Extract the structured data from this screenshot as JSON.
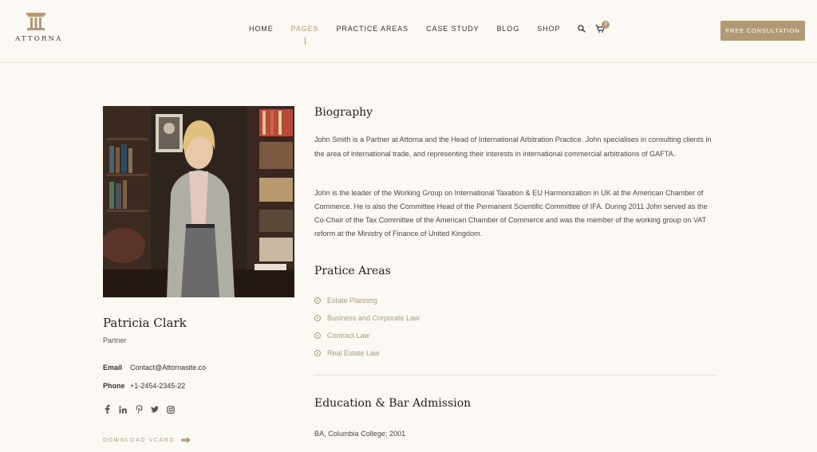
{
  "brand": {
    "name": "ATTORNA"
  },
  "nav": {
    "items": [
      "HOME",
      "PAGES",
      "PRACTICE AREAS",
      "CASE STUDY",
      "BLOG",
      "SHOP"
    ],
    "active_index": 1,
    "cart_count": "0"
  },
  "cta": {
    "label": "FREE CONSULTATION"
  },
  "profile": {
    "name": "Patricia Clark",
    "role": "Partner",
    "email_label": "Email",
    "email": "Contact@Attornasite.co",
    "phone_label": "Phone",
    "phone": "+1-2454-2345-22",
    "socials": [
      "facebook-icon",
      "linkedin-icon",
      "pinterest-icon",
      "twitter-icon",
      "instagram-icon"
    ],
    "vcard_label": "DOWNLOAD VCARD"
  },
  "biography": {
    "title": "Biography",
    "p1": "John Smith is a Partner at Attorna and the Head of International Arbitration Practice. John specialises in consulting clients in the area of international trade, and representing their interests in international commercial arbitrations of GAFTA.",
    "p2": "John is the leader of the Working Group on International Taxation & EU Harmonization in UK at the American Chamber of Commerce. He is also the Committee Head of the Permanent Scientific Committee of IFA. During 2011 John served as the Co-Chair of the Tax Committee of the American Chamber of Commerce and was the member of the working group on VAT reform at the Ministry of Finance of United Kingdom."
  },
  "practice": {
    "title": "Pratice Areas",
    "items": [
      "Estate Planning",
      "Business and Corporate Law",
      "Contract Law",
      "Real Estate Law"
    ]
  },
  "education": {
    "title": "Education & Bar Admission",
    "line1": "BA, Columbia College; 2001"
  },
  "colors": {
    "accent": "#b19a73",
    "background": "#fcf8f3"
  }
}
